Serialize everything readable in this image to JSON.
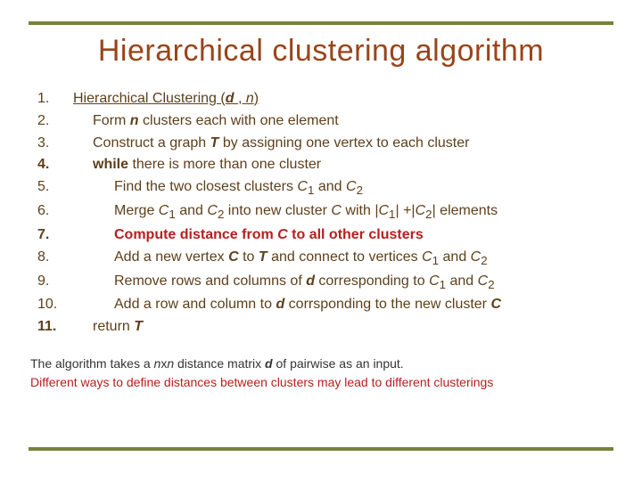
{
  "title": "Hierarchical clustering algorithm",
  "algo": {
    "nums": [
      "1.",
      "2.",
      "3.",
      "4.",
      "5.",
      "6.",
      "7.",
      "8.",
      "9.",
      "10.",
      "11."
    ],
    "l1_a": "Hierarchical Clustering (",
    "l1_d": "d",
    "l1_b": " , ",
    "l1_n": "n",
    "l1_c": ")",
    "l2_a": "Form ",
    "l2_n": "n",
    "l2_b": " clusters each with one element",
    "l3_a": "Construct a graph ",
    "l3_T": "T",
    "l3_b": "  by assigning one vertex to each cluster",
    "l4_a": "while",
    "l4_b": " there is more than one cluster",
    "l5_a": "Find the two closest clusters ",
    "l5_c1": "C",
    "l5_s1": "1",
    "l5_and": " and ",
    "l5_c2": "C",
    "l5_s2": "2",
    "l6_a": "Merge ",
    "l6_c1": "C",
    "l6_s1": "1",
    "l6_and": " and ",
    "l6_c2": "C",
    "l6_s2": "2",
    "l6_b": " into new cluster ",
    "l6_c": "C",
    "l6_with": " with |",
    "l6_c1b": "C",
    "l6_s1b": "1",
    "l6_plus": "| +|",
    "l6_c2b": "C",
    "l6_s2b": "2",
    "l6_end": "| elements",
    "l7_a": "Compute distance from ",
    "l7_c": "C",
    "l7_b": " to all other clusters",
    "l8_a": "Add a new vertex ",
    "l8_c": "C",
    "l8_to": " to ",
    "l8_T": "T",
    "l8_b": " and connect to vertices ",
    "l8_c1": "C",
    "l8_s1": "1",
    "l8_and": " and ",
    "l8_c2": "C",
    "l8_s2": "2",
    "l9_a": "Remove rows and columns of ",
    "l9_d": "d",
    "l9_b": " corresponding to ",
    "l9_c1": "C",
    "l9_s1": "1",
    "l9_and": " and ",
    "l9_c2": "C",
    "l9_s2": "2",
    "l10_a": "Add a row and column to ",
    "l10_d": "d",
    "l10_b": "  corrsponding to the new cluster ",
    "l10_c": "C",
    "l11_a": "return ",
    "l11_T": "T"
  },
  "footer": {
    "line1_a": "The algorithm takes a ",
    "line1_nxn": "n",
    "line1_x": "x",
    "line1_n2": "n",
    "line1_b": " distance matrix ",
    "line1_d": "d",
    "line1_c": " of pairwise as an input.",
    "line2": "Different ways to define distances between clusters may lead to different clusterings"
  }
}
